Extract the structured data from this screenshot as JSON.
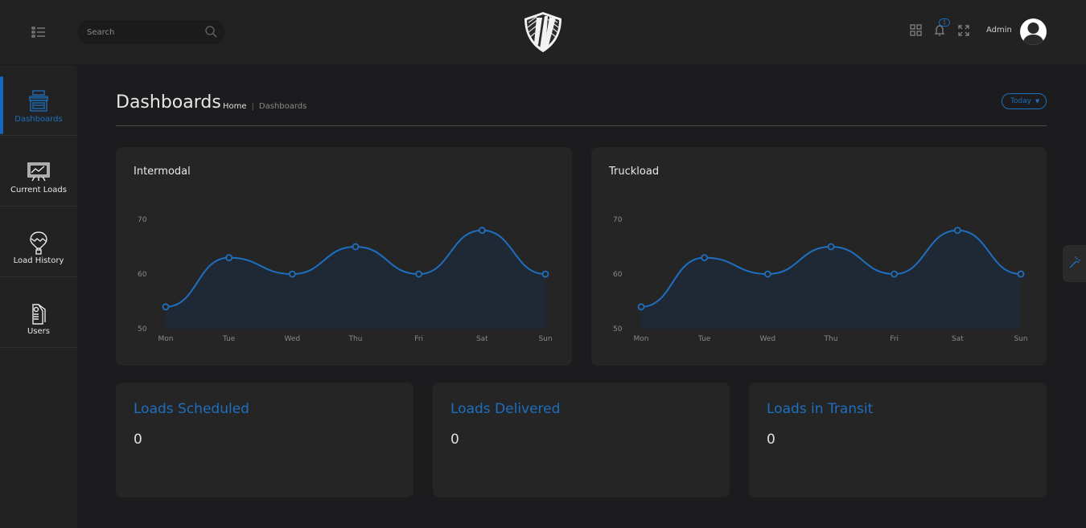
{
  "header": {
    "search_placeholder": "Search",
    "notification_count": "1",
    "user_name": "Admin"
  },
  "sidebar": {
    "items": [
      {
        "label": "Dashboards",
        "icon": "storefront-icon"
      },
      {
        "label": "Current Loads",
        "icon": "monitor-chart-icon"
      },
      {
        "label": "Load History",
        "icon": "hot-air-balloon-icon"
      },
      {
        "label": "Users",
        "icon": "id-badge-icon"
      }
    ]
  },
  "page": {
    "title": "Dashboards",
    "breadcrumb": {
      "home": "Home",
      "current": "Dashboards"
    },
    "range_select": "Today"
  },
  "colors": {
    "accent": "#1e6fbf",
    "card": "#252526",
    "background": "#1c1b1d"
  },
  "stats": [
    {
      "label": "Loads Scheduled",
      "value": "0"
    },
    {
      "label": "Loads Delivered",
      "value": "0"
    },
    {
      "label": "Loads in Transit",
      "value": "0"
    }
  ],
  "chart_data": [
    {
      "type": "area",
      "title": "Intermodal",
      "categories": [
        "Mon",
        "Tue",
        "Wed",
        "Thu",
        "Fri",
        "Sat",
        "Sun"
      ],
      "values": [
        54,
        63,
        60,
        65,
        60,
        68,
        60
      ],
      "ylim": [
        50,
        70
      ],
      "yticks": [
        50,
        60,
        70
      ],
      "grid": false
    },
    {
      "type": "area",
      "title": "Truckload",
      "categories": [
        "Mon",
        "Tue",
        "Wed",
        "Thu",
        "Fri",
        "Sat",
        "Sun"
      ],
      "values": [
        54,
        63,
        60,
        65,
        60,
        68,
        60
      ],
      "ylim": [
        50,
        70
      ],
      "yticks": [
        50,
        60,
        70
      ],
      "grid": false
    }
  ]
}
